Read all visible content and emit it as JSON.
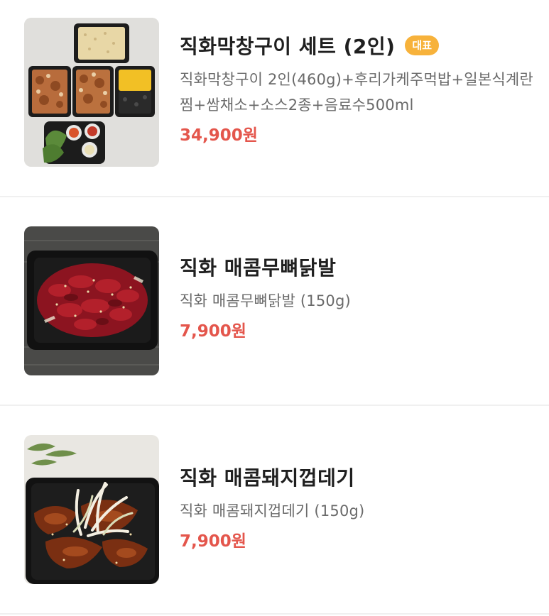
{
  "items": [
    {
      "name": "직화막창구이 세트 (2인)",
      "badge": "대표",
      "description": "직화막창구이 2인(460g)+후리가케주먹밥+일본식계란찜+쌈채소+소스2종+음료수500ml",
      "price": "34,900원"
    },
    {
      "name": "직화 매콤무뼈닭발",
      "description": "직화 매콤무뼈닭발 (150g)",
      "price": "7,900원"
    },
    {
      "name": "직화 매콤돼지껍데기",
      "description": "직화 매콤돼지껍데기 (150g)",
      "price": "7,900원"
    }
  ],
  "colors": {
    "price": "#e4564c",
    "badge": "#f7b23b",
    "name": "#1f1f1f",
    "description": "#6a6a6a",
    "divider": "#f0f0f0"
  },
  "icons": [
    "food-photo-set",
    "food-photo-chicken-feet",
    "food-photo-pork-skin"
  ]
}
